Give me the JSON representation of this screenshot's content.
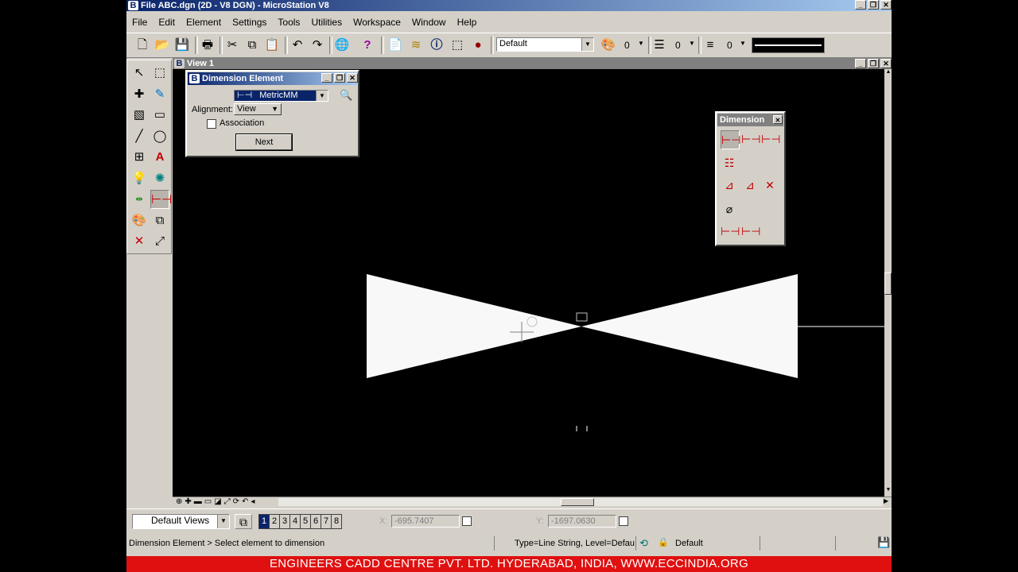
{
  "app": {
    "title": "File ABC.dgn (2D - V8 DGN) - MicroStation V8",
    "logo": "B"
  },
  "menu": [
    "File",
    "Edit",
    "Element",
    "Settings",
    "Tools",
    "Utilities",
    "Workspace",
    "Window",
    "Help"
  ],
  "toolbar": {
    "level_combo": "Default",
    "color_value": "0",
    "style_value": "0",
    "weight_value": "0"
  },
  "view": {
    "title": "View 1"
  },
  "dimension_dialog": {
    "title": "Dimension Element",
    "style_value": "MetricMM",
    "alignment_label": "Alignment:",
    "alignment_value": "View",
    "association_label": "Association",
    "next_label": "Next"
  },
  "dimension_toolbox": {
    "title": "Dimension"
  },
  "status": {
    "views_combo": "Default Views",
    "view_numbers": [
      "1",
      "2",
      "3",
      "4",
      "5",
      "6",
      "7",
      "8"
    ],
    "x_label": "X:",
    "x_value": "-695.7407",
    "y_label": "Y:",
    "y_value": "-1697.0630",
    "prompt": "Dimension Element > Select element to dimension",
    "element_info": "Type=Line String, Level=Defau",
    "level": "Default"
  },
  "banner": "ENGINEERS CADD CENTRE PVT. LTD. HYDERABAD, INDIA, WWW.ECCINDIA.ORG"
}
